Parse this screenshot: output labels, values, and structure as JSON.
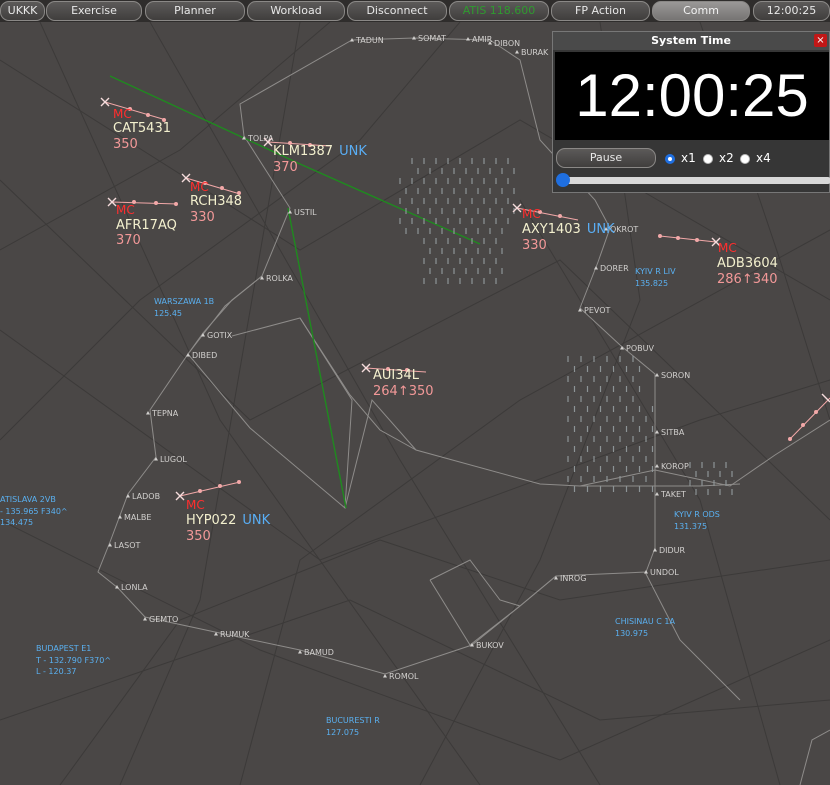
{
  "toolbar": {
    "buttons": [
      "UKKK",
      "Exercise",
      "Planner",
      "Workload",
      "Disconnect",
      "ATIS 118.600",
      "FP Action",
      "Comm",
      "12:00:25"
    ]
  },
  "system_time": {
    "title": "System Time",
    "close_label": "×",
    "time": "12:00:25",
    "pause_label": "Pause",
    "speeds": [
      "x1",
      "x2",
      "x4"
    ],
    "selected_speed": "x1",
    "sim_progress": 0.0
  },
  "waypoints": [
    "TADUN",
    "SOMAT",
    "AMIR",
    "DIBON",
    "BURAK",
    "TOLPA",
    "USTIL",
    "ROLKA",
    "DORER",
    "PEVOT",
    "POBUV",
    "SORON",
    "GOTIX",
    "DIBED",
    "TEPNA",
    "LUGOL",
    "LADOB",
    "MALBE",
    "LASOT",
    "LONLA",
    "GEMTO",
    "RUMUK",
    "BAMUD",
    "ROMOL",
    "BUKOV",
    "INROG",
    "UNDOL",
    "DIDUR",
    "SITBA",
    "KOROP",
    "TAKET",
    "OKROT"
  ],
  "sectors": {
    "warszawa": [
      "WARSZAWA 1B",
      "125.45"
    ],
    "kyiv_liv": [
      "KYIV R LIV",
      "135.825"
    ],
    "kyiv_ods": [
      "KYIV R ODS",
      "131.375"
    ],
    "bratislava": [
      "ATISLAVA 2VB",
      "- 135.965 F340^",
      "134.475"
    ],
    "budapest": [
      "BUDAPEST E1",
      "T - 132.790 F370^",
      "L - 120.37"
    ],
    "chisinau": [
      "CHISINAU C 1A",
      "130.975"
    ],
    "bucuresti": [
      "BUCURESTI R",
      "127.075"
    ]
  },
  "aircraft": {
    "cat5431": {
      "mc": "MC",
      "callsign": "CAT5431",
      "level": "350"
    },
    "klm1387": {
      "callsign": "KLM1387",
      "status": "UNK",
      "level": "370"
    },
    "rch348": {
      "mc": "MC",
      "callsign": "RCH348",
      "level": "330"
    },
    "afr17aq": {
      "mc": "MC",
      "callsign": "AFR17AQ",
      "level": "370"
    },
    "axy1403": {
      "mc": "MC",
      "callsign": "AXY1403",
      "status": "UNK",
      "level": "330"
    },
    "adb3604": {
      "mc": "MC",
      "callsign": "ADB3604",
      "level": "286↑340"
    },
    "aui34l": {
      "callsign": "AUI34L",
      "level": "264↑350"
    },
    "hyp022": {
      "mc": "MC",
      "callsign": "HYP022",
      "status": "UNK",
      "level": "350"
    }
  },
  "colors": {
    "background": "#4a4746",
    "callsign": "#f3f0ce",
    "flight_level": "#f29898",
    "mc_label": "#ff2e2e",
    "unk_label": "#59aef5",
    "route": "#1f8a1f",
    "sector_label": "#5ab0f0"
  }
}
